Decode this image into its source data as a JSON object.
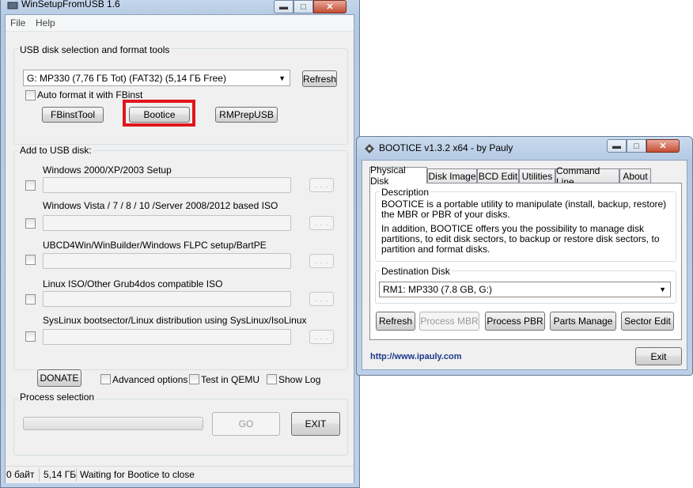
{
  "main_window": {
    "title": "WinSetupFromUSB 1.6",
    "menu": [
      "File",
      "Help"
    ],
    "usb_section": {
      "heading": "USB disk selection and format tools",
      "disk_selected": "G: MP330 (7,76 ГБ Tot) (FAT32) (5,14 ГБ Free)",
      "refresh_label": "Refresh",
      "auto_format_label": "Auto format it with FBinst",
      "fbinst_label": "FBinstTool",
      "bootice_label": "Bootice",
      "rmprep_label": "RMPrepUSB",
      "highlight_color": "#e0161c"
    },
    "add_section": {
      "heading": "Add to USB disk:",
      "items": [
        {
          "label": "Windows 2000/XP/2003 Setup"
        },
        {
          "label": "Windows Vista / 7 / 8 / 10 /Server 2008/2012 based ISO"
        },
        {
          "label": "UBCD4Win/WinBuilder/Windows FLPC setup/BartPE"
        },
        {
          "label": "Linux ISO/Other Grub4dos compatible ISO"
        },
        {
          "label": "SysLinux bootsector/Linux distribution using SysLinux/IsoLinux"
        }
      ],
      "browse_label": ". . ."
    },
    "options": {
      "donate_label": "DONATE",
      "advanced_label": "Advanced options",
      "qemu_label": "Test in QEMU",
      "showlog_label": "Show Log"
    },
    "process": {
      "heading": "Process selection",
      "go_label": "GO",
      "exit_label": "EXIT"
    },
    "status_bar": {
      "free_space": "0 байт",
      "size": "5,14 ГБ",
      "message": "Waiting for Bootice to close"
    }
  },
  "bootice_window": {
    "title": "BOOTICE v1.3.2 x64 - by Pauly",
    "tabs": [
      "Physical Disk",
      "Disk Image",
      "BCD Edit",
      "Utilities",
      "Command Line",
      "About"
    ],
    "active_tab": "Physical Disk",
    "description": {
      "heading": "Description",
      "para1": "BOOTICE is a portable utility to manipulate (install, backup, restore) the MBR or PBR of your disks.",
      "para2": "In addition, BOOTICE offers you the possibility to manage disk partitions, to edit disk sectors, to backup or restore disk sectors, to partition and format disks."
    },
    "destination": {
      "heading": "Destination Disk",
      "selected": "RM1: MP330 (7.8 GB, G:)"
    },
    "buttons": {
      "refresh": "Refresh",
      "process_mbr": "Process MBR",
      "process_pbr": "Process PBR",
      "parts_manage": "Parts Manage",
      "sector_edit": "Sector Edit"
    },
    "link": "http://www.ipauly.com",
    "link_color": "#1a3a8c",
    "exit_label": "Exit"
  }
}
